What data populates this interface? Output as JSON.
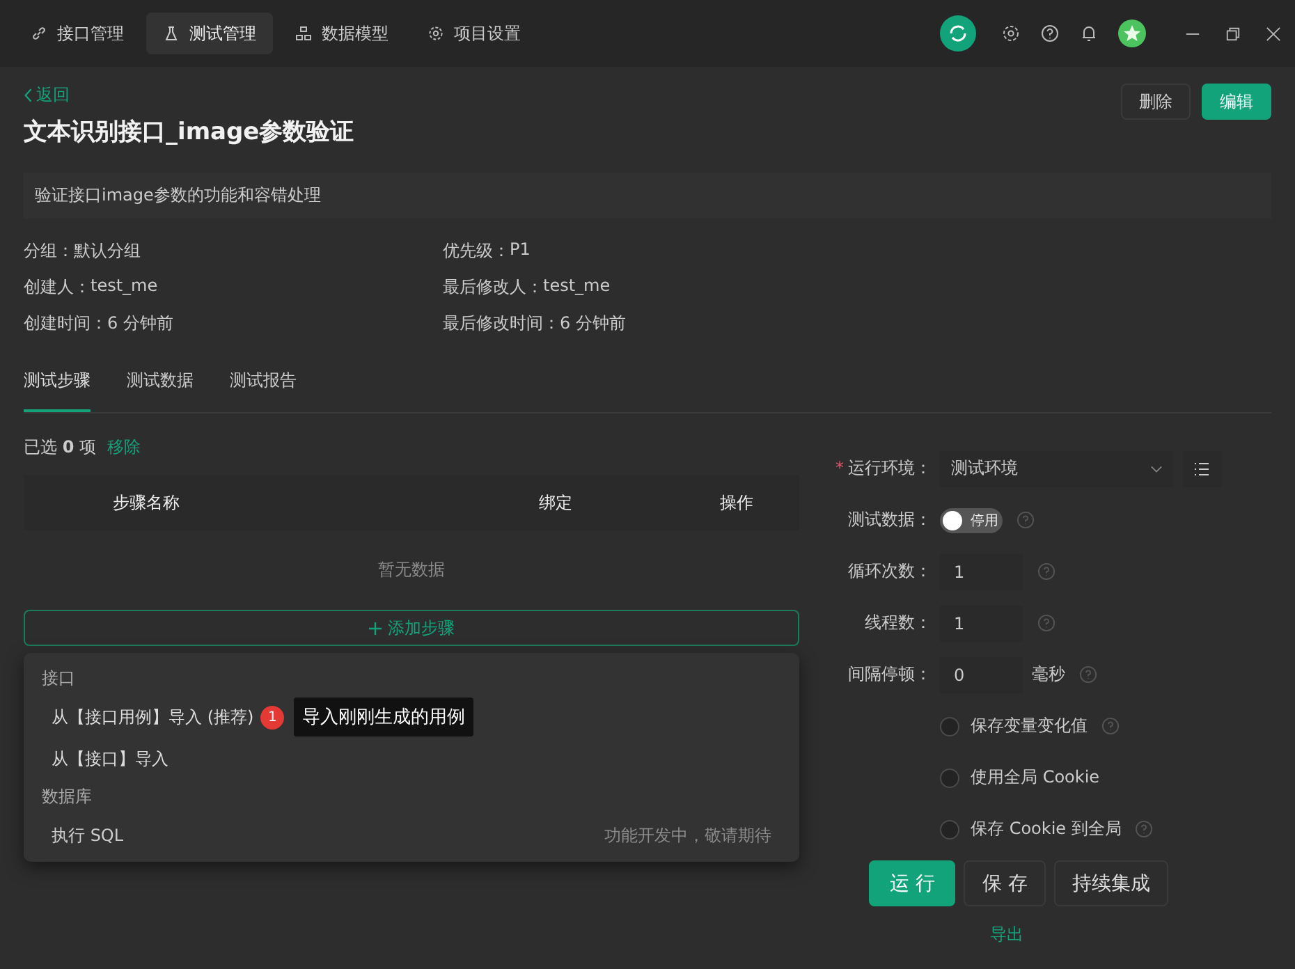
{
  "nav": [
    {
      "label": "接口管理",
      "selected": false
    },
    {
      "label": "测试管理",
      "selected": true
    },
    {
      "label": "数据模型",
      "selected": false
    },
    {
      "label": "项目设置",
      "selected": false
    }
  ],
  "back": "返回",
  "title": "文本识别接口_image参数验证",
  "actions": [
    {
      "label": "删除",
      "kind": "default"
    },
    {
      "label": "编辑",
      "kind": "primary"
    }
  ],
  "description": "验证接口image参数的功能和容错处理",
  "meta": [
    {
      "label": "分组：",
      "value": "默认分组"
    },
    {
      "label": "优先级：",
      "value": "P1"
    },
    {
      "label": "创建人：",
      "value": "test_me"
    },
    {
      "label": "最后修改人：",
      "value": "test_me"
    },
    {
      "label": "创建时间：",
      "value": "6 分钟前"
    },
    {
      "label": "最后修改时间：",
      "value": "6 分钟前"
    }
  ],
  "subtabs": [
    {
      "label": "测试步骤",
      "selected": true
    },
    {
      "label": "测试数据",
      "selected": false
    },
    {
      "label": "测试报告",
      "selected": false
    }
  ],
  "selection": {
    "text": "已选 **0** 项",
    "action": "移除"
  },
  "table": {
    "columns": [
      "步骤名称",
      "绑定",
      "操作"
    ],
    "empty": "暂无数据"
  },
  "add_step": "添加步骤",
  "menu": [
    {
      "title": "接口",
      "items": [
        {
          "label": "从【接口用例】导入 (推荐)",
          "disabled": false,
          "badge": "1",
          "tooltip": "导入刚刚生成的用例"
        },
        {
          "label": "从【接口】导入",
          "disabled": false
        }
      ]
    },
    {
      "title": "数据库",
      "items": [
        {
          "label": "执行 SQL",
          "disabled": true,
          "note": "功能开发中，敬请期待"
        }
      ]
    }
  ],
  "env": {
    "required_mark": "*",
    "label": "运行环境：",
    "value": "测试环境"
  },
  "test_data": {
    "label": "测试数据：",
    "on": false,
    "text": "停用",
    "help": true
  },
  "fields": [
    {
      "label": "循环次数：",
      "value": "1",
      "help": true
    },
    {
      "label": "线程数：",
      "value": "1",
      "help": true
    },
    {
      "label": "间隔停顿：",
      "value": "0",
      "unit": "毫秒",
      "help": true
    }
  ],
  "options": [
    {
      "label": "保存变量变化值",
      "checked": false,
      "help": true
    },
    {
      "label": "使用全局 Cookie",
      "checked": false,
      "help": false
    },
    {
      "label": "保存 Cookie 到全局",
      "checked": false,
      "help": true
    }
  ],
  "run_buttons": [
    {
      "label": "运 行",
      "kind": "primary"
    },
    {
      "label": "保 存",
      "kind": "default"
    },
    {
      "label": "持续集成",
      "kind": "default"
    }
  ],
  "export": "导出"
}
